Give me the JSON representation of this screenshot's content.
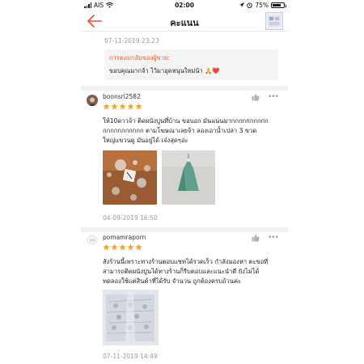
{
  "status_bar": {
    "carrier": "AIS",
    "time": "02:00",
    "battery": "75%",
    "battery_level": 0.75
  },
  "nav": {
    "title": "คะแนน",
    "back_icon": "back-arrow-icon"
  },
  "previous_review": {
    "date": "07-11-2019 23:23"
  },
  "seller_reply": {
    "title": "การตอบกลับของผู้ขาย:",
    "text": "ขอบคุณมากจ้า ไว้มาอุดหนุนใหม่น้า 🙏❤️"
  },
  "reviews": [
    {
      "username": "boonsri2582",
      "rating": 5,
      "text_lines": [
        "ให้10ดาวจ้า  ติดผนังปูนที่บ้าน ขอบอก มันแน่นมากกกกกกกกกก",
        "กกกกกกกกกกก ตามโฆษณาเลยจ้า ลองเอาน้ำเปล่า 3 ขวด",
        "ใหญ่แขวนดู มันอยู่ได้ เจ๋งสุดๆอ่ะ"
      ],
      "date": "04-09-2019 16:50"
    },
    {
      "username": "pomamraporn",
      "rating": 5,
      "text_lines": [
        "สั่งร้านนี้เพราะทางร้านตอบแชทได้รวดเร็ว กำลังมองหา ตะขอที่",
        "สามารถติดผนังปูนได้ทางร้านก็รีบตอบและแนะนำดี ยังไม่ได้",
        "ทดลองใช้แต่สินค้าที่ได้รับ จำนวน ถูกต้องครบถ้วนค่ะ"
      ],
      "date": "07-11-2019 14:49"
    }
  ],
  "colors": {
    "accent": "#ee4d2d",
    "star": "#f5a623",
    "reply_title": "#e8602c"
  }
}
